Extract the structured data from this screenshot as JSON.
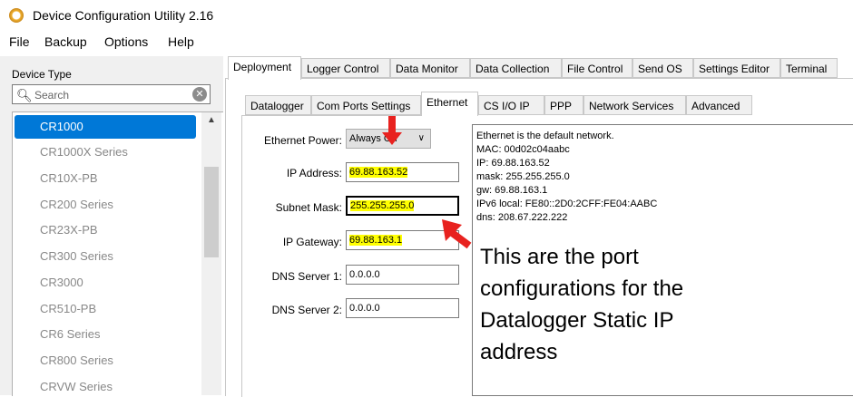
{
  "window": {
    "title": "Device Configuration Utility 2.16"
  },
  "menu": [
    "File",
    "Backup",
    "Options",
    "Help"
  ],
  "sidebar": {
    "label": "Device Type",
    "search_placeholder": "Search",
    "items": [
      "CR1000",
      "CR1000X Series",
      "CR10X-PB",
      "CR200 Series",
      "CR23X-PB",
      "CR300 Series",
      "CR3000",
      "CR510-PB",
      "CR6 Series",
      "CR800 Series",
      "CRVW Series"
    ],
    "selected": "CR1000"
  },
  "main_tabs": [
    "Deployment",
    "Logger Control",
    "Data Monitor",
    "Data Collection",
    "File Control",
    "Send OS",
    "Settings Editor",
    "Terminal"
  ],
  "sub_tabs": [
    "Datalogger",
    "Com Ports Settings",
    "Ethernet",
    "CS I/O IP",
    "PPP",
    "Network Services",
    "Advanced"
  ],
  "ethernet": {
    "power_label": "Ethernet Power:",
    "power_value": "Always On",
    "ip_label": "IP Address:",
    "ip_value": "69.88.163.52",
    "mask_label": "Subnet Mask:",
    "mask_value": "255.255.255.0",
    "gateway_label": "IP Gateway:",
    "gateway_value": "69.88.163.1",
    "dns1_label": "DNS Server 1:",
    "dns1_value": "0.0.0.0",
    "dns2_label": "DNS Server 2:",
    "dns2_value": "0.0.0.0"
  },
  "info": {
    "lines": [
      "Ethernet is the default network.",
      "MAC: 00d02c04aabc",
      "IP: 69.88.163.52",
      "mask: 255.255.255.0",
      "gw: 69.88.163.1",
      "IPv6 local: FE80::2D0:2CFF:FE04:AABC",
      "dns: 208.67.222.222"
    ],
    "annotation": "This are the port configurations for the Datalogger Static IP address"
  },
  "colors": {
    "selection": "#0078d7",
    "highlight": "#ffff00",
    "arrow": "#e8221f"
  }
}
